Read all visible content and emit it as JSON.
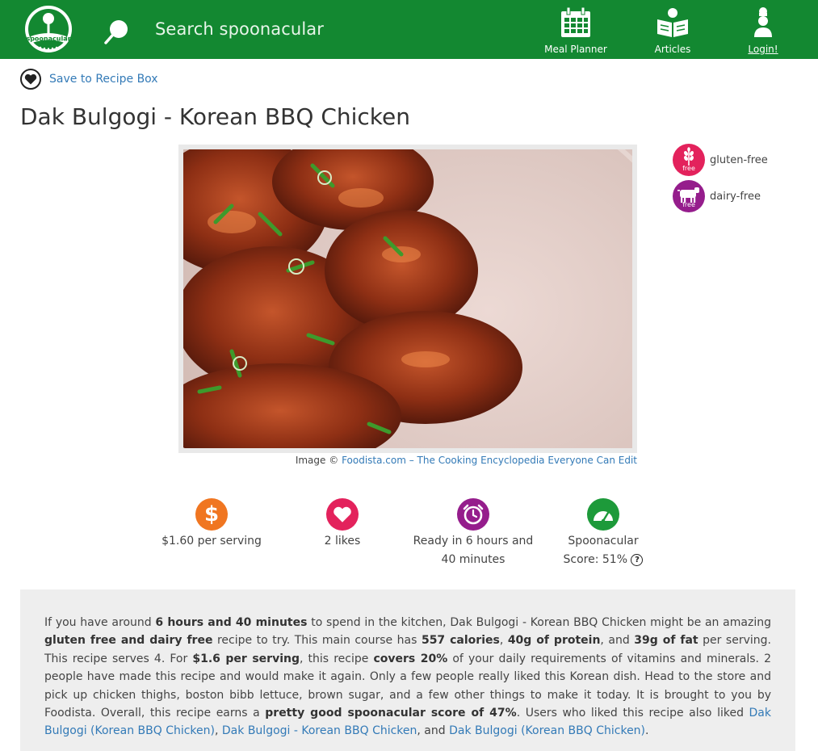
{
  "header": {
    "logo_text": "spoonacular",
    "search_placeholder": "Search spoonacular",
    "nav": [
      {
        "label": "Meal Planner",
        "icon": "calendar-icon"
      },
      {
        "label": "Articles",
        "icon": "book-reader-icon"
      },
      {
        "label": "Login!",
        "icon": "chef-icon"
      }
    ],
    "bar_color": "#138831"
  },
  "save": {
    "label": "Save to Recipe Box"
  },
  "recipe": {
    "title": "Dak Bulgogi - Korean BBQ Chicken",
    "image_credit_prefix": "Image ©",
    "image_credit_link": "Foodista.com – The Cooking Encyclopedia Everyone Can Edit"
  },
  "badges": [
    {
      "label": "gluten-free",
      "sub": "free",
      "color": "#e3225c",
      "icon": "wheat-icon"
    },
    {
      "label": "dairy-free",
      "sub": "free",
      "color": "#951d8c",
      "icon": "cow-icon"
    }
  ],
  "stats": {
    "price": {
      "text": "$1.60 per serving",
      "color": "#f07621",
      "icon": "dollar-icon"
    },
    "likes": {
      "text": "2 likes",
      "color": "#e3225c",
      "icon": "heart-icon"
    },
    "ready": {
      "line1": "Ready in 6 hours and",
      "line2": "40 minutes",
      "color": "#951d8c",
      "icon": "alarm-clock-icon"
    },
    "score": {
      "line1": "Spoonacular",
      "line2": "Score: 51%",
      "help": "?",
      "color": "#1d9a3a",
      "icon": "gauge-icon"
    }
  },
  "summary": {
    "t1": "If you have around ",
    "b1": "6 hours and 40 minutes",
    "t2": " to spend in the kitchen, Dak Bulgogi - Korean BBQ Chicken might be an amazing ",
    "b2": "gluten free and dairy free",
    "t3": " recipe to try. This main course has ",
    "b3": "557 calories",
    "t4": ", ",
    "b4": "40g of protein",
    "t5": ", and ",
    "b5": "39g of fat",
    "t6": " per serving. This recipe serves 4. For ",
    "b6": "$1.6 per serving",
    "t7": ", this recipe ",
    "b7": "covers 20%",
    "t8": " of your daily requirements of vitamins and minerals. 2 people have made this recipe and would make it again. Only a few people really liked this Korean dish. Head to the store and pick up chicken thighs, boston bibb lettuce, brown sugar, and a few other things to make it today. It is brought to you by Foodista. Overall, this recipe earns a ",
    "b8": "pretty good spoonacular score of 47%",
    "t9": ". Users who liked this recipe also liked ",
    "link1": "Dak Bulgogi (Korean BBQ Chicken)",
    "t10": ", ",
    "link2": "Dak Bulgogi - Korean BBQ Chicken",
    "t11": ", and ",
    "link3": "Dak Bulgogi (Korean BBQ Chicken)",
    "t12": "."
  }
}
